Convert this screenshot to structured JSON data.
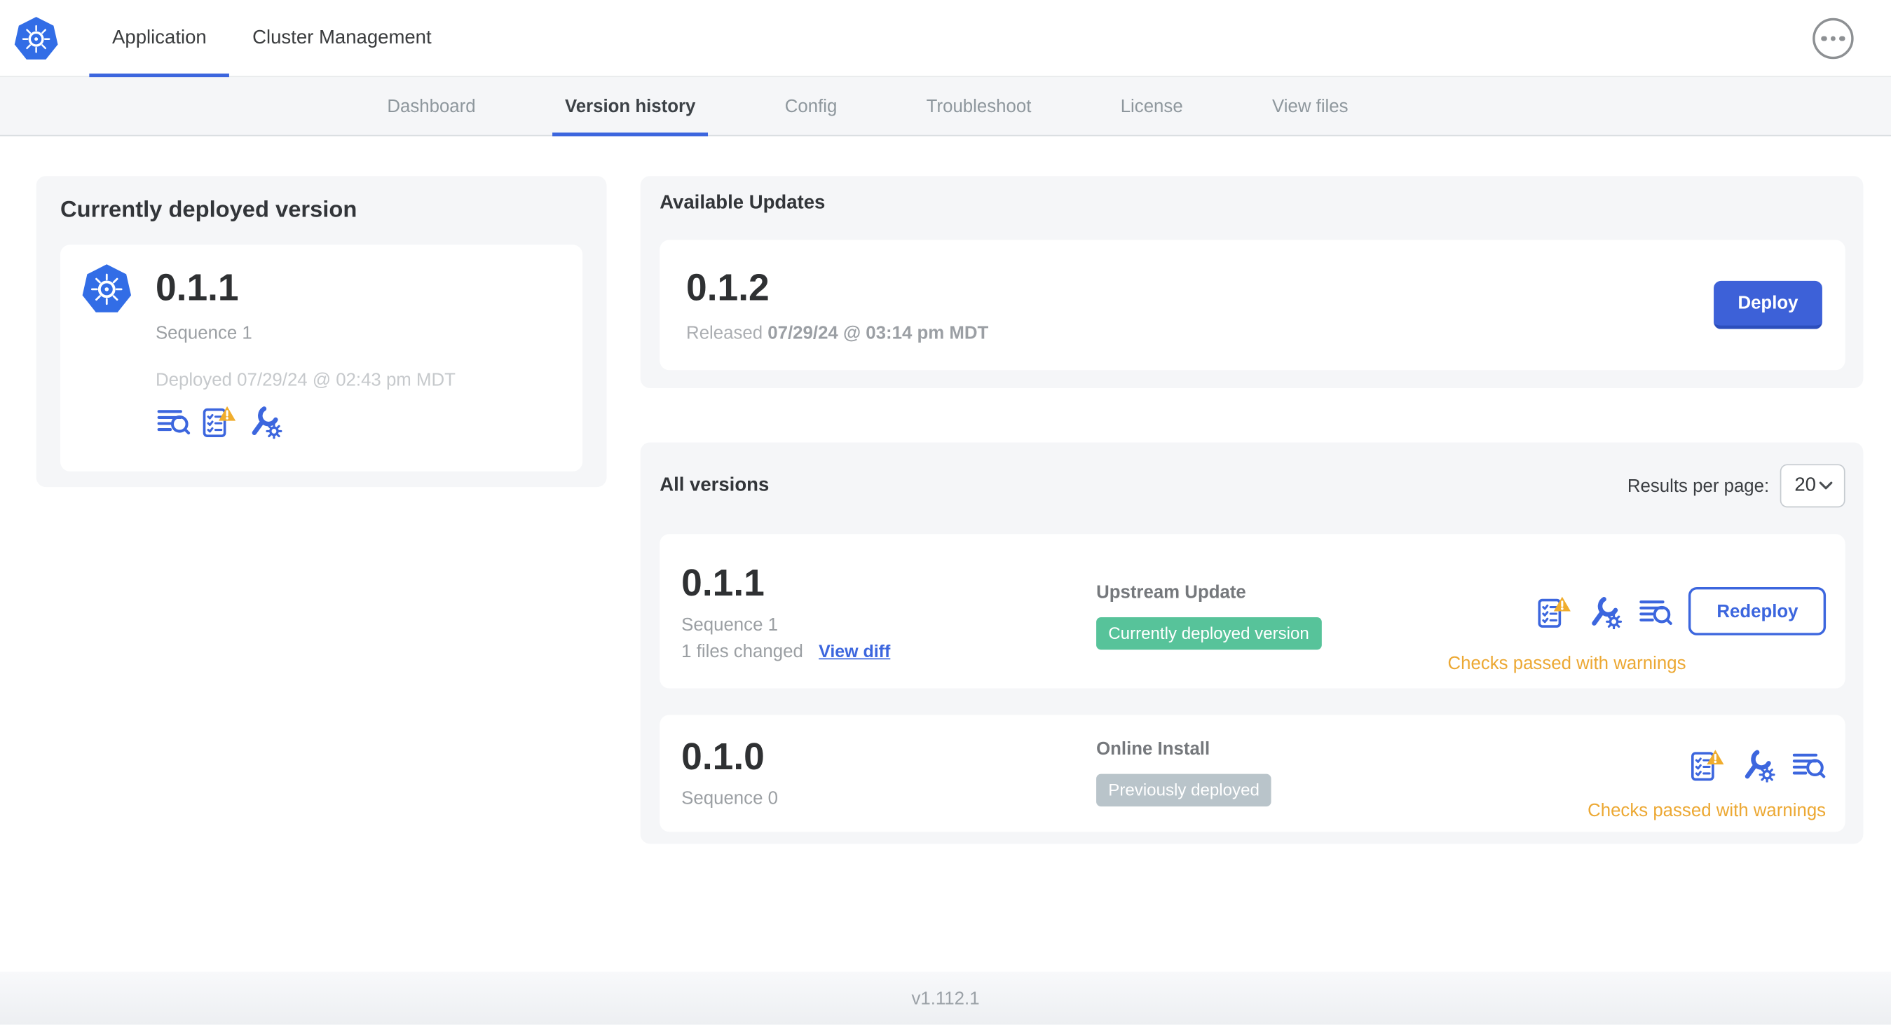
{
  "topbar": {
    "tabs": [
      {
        "label": "Application",
        "active": true
      },
      {
        "label": "Cluster Management",
        "active": false
      }
    ]
  },
  "subnav": {
    "tabs": [
      {
        "label": "Dashboard",
        "active": false
      },
      {
        "label": "Version history",
        "active": true
      },
      {
        "label": "Config",
        "active": false
      },
      {
        "label": "Troubleshoot",
        "active": false
      },
      {
        "label": "License",
        "active": false
      },
      {
        "label": "View files",
        "active": false
      }
    ]
  },
  "current_version": {
    "title": "Currently deployed version",
    "version": "0.1.1",
    "sequence": "Sequence 1",
    "deployed": "Deployed 07/29/24 @ 02:43 pm MDT"
  },
  "available_updates": {
    "title": "Available Updates",
    "version": "0.1.2",
    "released_label": "Released",
    "released_at": "07/29/24 @ 03:14 pm MDT",
    "deploy_label": "Deploy"
  },
  "all_versions": {
    "title": "All versions",
    "results_per_page_label": "Results per page:",
    "results_per_page": "20",
    "rows": [
      {
        "version": "0.1.1",
        "sequence": "Sequence 1",
        "files_changed": "1 files changed",
        "view_diff_label": "View diff",
        "source": "Upstream Update",
        "badge": "Currently deployed version",
        "badge_type": "green",
        "action_label": "Redeploy",
        "status": "Checks passed with warnings"
      },
      {
        "version": "0.1.0",
        "sequence": "Sequence 0",
        "source": "Online Install",
        "badge": "Previously deployed",
        "badge_type": "gray",
        "status": "Checks passed with warnings"
      }
    ]
  },
  "footer": {
    "app_version": "v1.112.1"
  },
  "colors": {
    "accent_blue": "#3c66de",
    "kubernetes_blue": "#326de6",
    "deploy_blue": "#3d61d8",
    "badge_green": "#57c39a",
    "badge_gray": "#b9c4ca",
    "warning_amber": "#eca833",
    "card_background": "#f5f6f8"
  }
}
